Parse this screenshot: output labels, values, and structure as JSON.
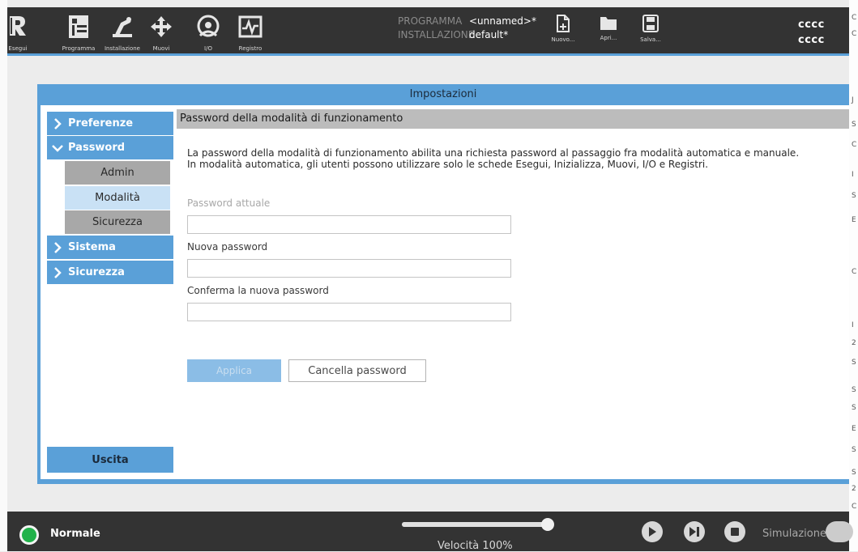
{
  "nav": {
    "items": [
      {
        "label": "Esegui",
        "icon": "ur-logo-icon"
      },
      {
        "label": "Programma",
        "icon": "program-icon"
      },
      {
        "label": "Installazione",
        "icon": "installation-icon"
      },
      {
        "label": "Muovi",
        "icon": "move-icon"
      },
      {
        "label": "I/O",
        "icon": "io-icon"
      },
      {
        "label": "Registro",
        "icon": "log-icon"
      }
    ]
  },
  "program": {
    "program_key": "PROGRAMMA",
    "program_value": "<unnamed>*",
    "install_key": "INSTALLAZIONE",
    "install_value": "default*"
  },
  "file_actions": {
    "new_label": "Nuovo...",
    "open_label": "Apri...",
    "save_label": "Salva..."
  },
  "user": {
    "line1": "cccc",
    "line2": "cccc"
  },
  "settings": {
    "title": "Impostazioni",
    "sidebar": {
      "preferences": "Preferenze",
      "password": "Password",
      "sub": [
        "Admin",
        "Modalità",
        "Sicurezza"
      ],
      "system": "Sistema",
      "safety": "Sicurezza",
      "exit": "Uscita"
    },
    "section_title": "Password della modalità di funzionamento",
    "description_1": "La password della modalità di funzionamento abilita una richiesta password al passaggio fra modalità automatica e manuale.",
    "description_2": "In modalità automatica, gli utenti possono utilizzare solo le schede Esegui, Inizializza, Muovi, I/O e Registri.",
    "current_label": "Password attuale",
    "new_label": "Nuova password",
    "confirm_label": "Conferma la nuova password",
    "apply_label": "Applica",
    "clear_label": "Cancella password"
  },
  "status": {
    "mode": "Normale",
    "speed_text": "Velocità 100%",
    "speed_fraction": 1.0,
    "simulation_label": "Simulazione"
  },
  "colors": {
    "accent": "#5aa0d8",
    "topbar": "#333333",
    "status_ok": "#21b24a"
  }
}
